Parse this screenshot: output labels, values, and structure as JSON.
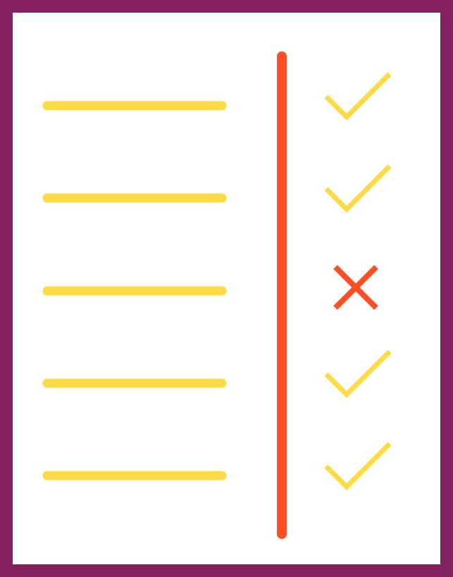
{
  "illustration": {
    "kind": "checklist-icon",
    "colors": {
      "frame": "#84215f",
      "background": "#ffffff",
      "line": "#fddb45",
      "divider": "#ff4f24",
      "check": "#fddb45",
      "cross": "#ff4f24"
    },
    "rows": [
      {
        "status": "check",
        "icon": "checkmark-icon"
      },
      {
        "status": "check",
        "icon": "checkmark-icon"
      },
      {
        "status": "cross",
        "icon": "x-mark-icon"
      },
      {
        "status": "check",
        "icon": "checkmark-icon"
      },
      {
        "status": "check",
        "icon": "checkmark-icon"
      }
    ]
  }
}
